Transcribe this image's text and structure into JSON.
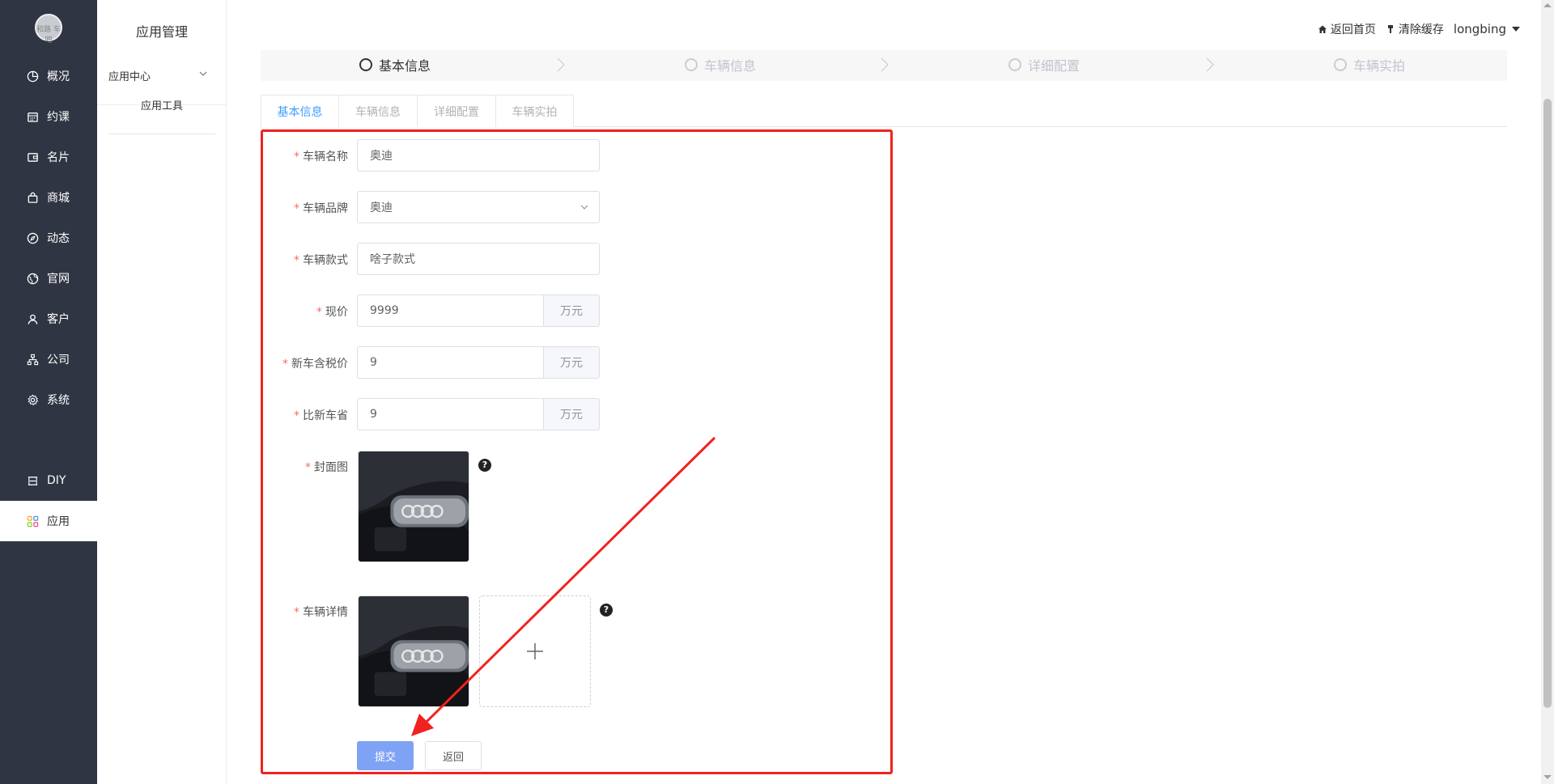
{
  "sidebar": {
    "logo_text": "和路\n车吧",
    "items": [
      {
        "label": "概况",
        "icon": "pie-chart-icon"
      },
      {
        "label": "约课",
        "icon": "calendar-icon"
      },
      {
        "label": "名片",
        "icon": "card-icon"
      },
      {
        "label": "商城",
        "icon": "shopping-bag-icon"
      },
      {
        "label": "动态",
        "icon": "compass-icon"
      },
      {
        "label": "官网",
        "icon": "globe-icon"
      },
      {
        "label": "客户",
        "icon": "user-icon"
      },
      {
        "label": "公司",
        "icon": "org-chart-icon"
      },
      {
        "label": "系统",
        "icon": "gear-icon"
      },
      {
        "label": "DIY",
        "icon": "diy-icon"
      },
      {
        "label": "应用",
        "icon": "apps-grid-icon",
        "active": true
      }
    ]
  },
  "subbar": {
    "title": "应用管理",
    "group": "应用中心",
    "item": "应用工具"
  },
  "header": {
    "home_link": "返回首页",
    "clear_cache": "清除缓存",
    "username": "longbing"
  },
  "steps": [
    {
      "label": "基本信息",
      "active": true
    },
    {
      "label": "车辆信息",
      "active": false
    },
    {
      "label": "详细配置",
      "active": false
    },
    {
      "label": "车辆实拍",
      "active": false
    }
  ],
  "tabs": [
    {
      "label": "基本信息",
      "active": true
    },
    {
      "label": "车辆信息",
      "active": false
    },
    {
      "label": "详细配置",
      "active": false
    },
    {
      "label": "车辆实拍",
      "active": false
    }
  ],
  "form": {
    "name_label": "车辆名称",
    "name_value": "奥迪",
    "brand_label": "车辆品牌",
    "brand_value": "奥迪",
    "model_label": "车辆款式",
    "model_value": "啥子款式",
    "price_label": "现价",
    "price_value": "9999",
    "new_price_label": "新车含税价",
    "new_price_value": "9",
    "save_label": "比新车省",
    "save_value": "9",
    "unit": "万元",
    "cover_label": "封面图",
    "detail_label": "车辆详情",
    "help_glyph": "?",
    "submit": "提交",
    "back": "返回"
  },
  "colors": {
    "sidebar_bg": "#2f3542",
    "primary": "#409eff",
    "submit_bg": "#7fa3f4",
    "annotation_red": "#f0221f",
    "required": "#f56c6c"
  }
}
